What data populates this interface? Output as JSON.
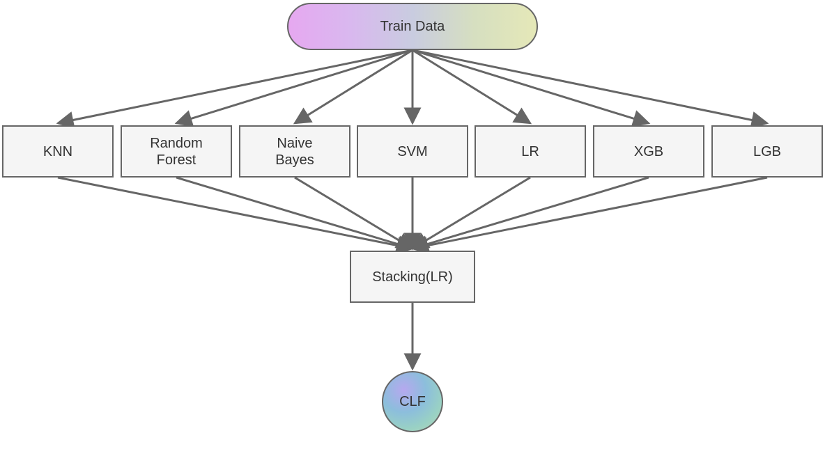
{
  "diagram": {
    "train": "Train Data",
    "knn": "KNN",
    "rf": "Random\nForest",
    "nb": "Naive\nBayes",
    "svm": "SVM",
    "lr": "LR",
    "xgb": "XGB",
    "lgb": "LGB",
    "stacking": "Stacking(LR)",
    "clf": "CLF"
  }
}
